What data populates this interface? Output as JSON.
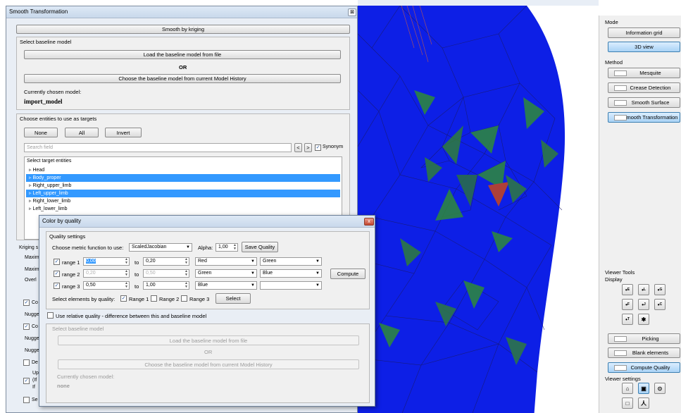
{
  "smooth_window": {
    "title": "Smooth Transformation",
    "close_glyph": "⊠",
    "smooth_by_kriging": "Smooth by kriging",
    "baseline": {
      "section_label": "Select baseline model",
      "load_button": "Load the baseline model from file",
      "or_label": "OR",
      "choose_button": "Choose the baseline model from current Model History",
      "current_label": "Currently chosen model:",
      "current_value": "import_model"
    },
    "targets": {
      "section_label": "Choose entities to use as targets",
      "none_button": "None",
      "all_button": "All",
      "invert_button": "Invert",
      "search_placeholder": "Search field",
      "prev_button": "<",
      "next_button": ">",
      "synonym_label": "Synonym",
      "tree_header": "Select target entities",
      "items": [
        {
          "label": "Head",
          "selected": false
        },
        {
          "label": "Body_proper",
          "selected": true
        },
        {
          "label": "Right_upper_limb",
          "selected": false
        },
        {
          "label": "Left_upper_limb",
          "selected": true
        },
        {
          "label": "Right_lower_limb",
          "selected": false
        },
        {
          "label": "Left_lower_limb",
          "selected": false
        }
      ]
    },
    "hidden_rows": {
      "kriging": "Kriging s",
      "maxim1": "Maxim",
      "maxim2": "Maxim",
      "overl": "Overl",
      "co1": "Co",
      "nugge1": "Nugge",
      "co2": "Co",
      "nugge2": "Nugge",
      "nugge3": "Nugge",
      "de": "De",
      "up": "Up",
      "if1": "(If",
      "if2": "If",
      "se": "Se"
    }
  },
  "color_by_quality": {
    "title": "Color by quality",
    "close_glyph": "x",
    "quality_settings_label": "Quality settings",
    "metric_label": "Choose metric function to use:",
    "metric_value": "ScaledJacobian",
    "alpha_label": "Alpha:",
    "alpha_value": "1,00",
    "save_quality_button": "Save Quality",
    "to_label": "to",
    "ranges": [
      {
        "label": "range 1",
        "from": "0,00",
        "to": "0,20",
        "color1": "Red",
        "color2": "Green",
        "checked": true
      },
      {
        "label": "range 2",
        "from": "0,20",
        "to": "0,50",
        "color1": "Green",
        "color2": "Blue",
        "checked": true
      },
      {
        "label": "range 3",
        "from": "0,50",
        "to": "1,00",
        "color1": "Blue",
        "color2": "",
        "checked": true
      }
    ],
    "compute_button": "Compute",
    "select_by_quality_label": "Select elements by quality:",
    "select_range1": "Range 1",
    "select_range2": "Range 2",
    "select_range3": "Range 3",
    "select_button": "Select",
    "relative_quality_label": "Use relative quality - difference between this and baseline model",
    "baseline_section_label": "Select baseline model",
    "load_button": "Load the baseline model from file",
    "or_label": "OR",
    "choose_button": "Choose the baseline model from current Model History",
    "current_label": "Currently chosen model:",
    "current_value": "none"
  },
  "right_panel": {
    "mode_label": "Mode",
    "information_grid": "Information grid",
    "view_3d": "3D view",
    "method_label": "Method",
    "mesquite": "Mesquite",
    "crease_detection": "Crease Detection",
    "smooth_surface": "Smooth Surface",
    "smooth_transformation": "Smooth Transformation",
    "viewer_tools_label": "Viewer Tools",
    "display_label": "Display",
    "display_buttons": [
      {
        "glyph": "•",
        "sub": "E"
      },
      {
        "glyph": "•",
        "sub": "L"
      },
      {
        "glyph": "•",
        "sub": "G"
      },
      {
        "glyph": "•",
        "sub": "F"
      },
      {
        "glyph": "•",
        "sub": "J"
      },
      {
        "glyph": "•",
        "sub": "C"
      },
      {
        "glyph": "•",
        "sub": "T"
      },
      {
        "glyph": "✱",
        "sub": ""
      }
    ],
    "picking": "Picking",
    "blank_elements": "Blank elements",
    "compute_quality": "Compute Quality",
    "viewer_settings_label": "Viewer settings"
  },
  "colors": {
    "mesh_blue": "#0a1ee0",
    "mesh_green": "#2e8a3a",
    "mesh_red": "#c9461a",
    "selection": "#3399ff",
    "window_bg": "#e9eef5"
  }
}
